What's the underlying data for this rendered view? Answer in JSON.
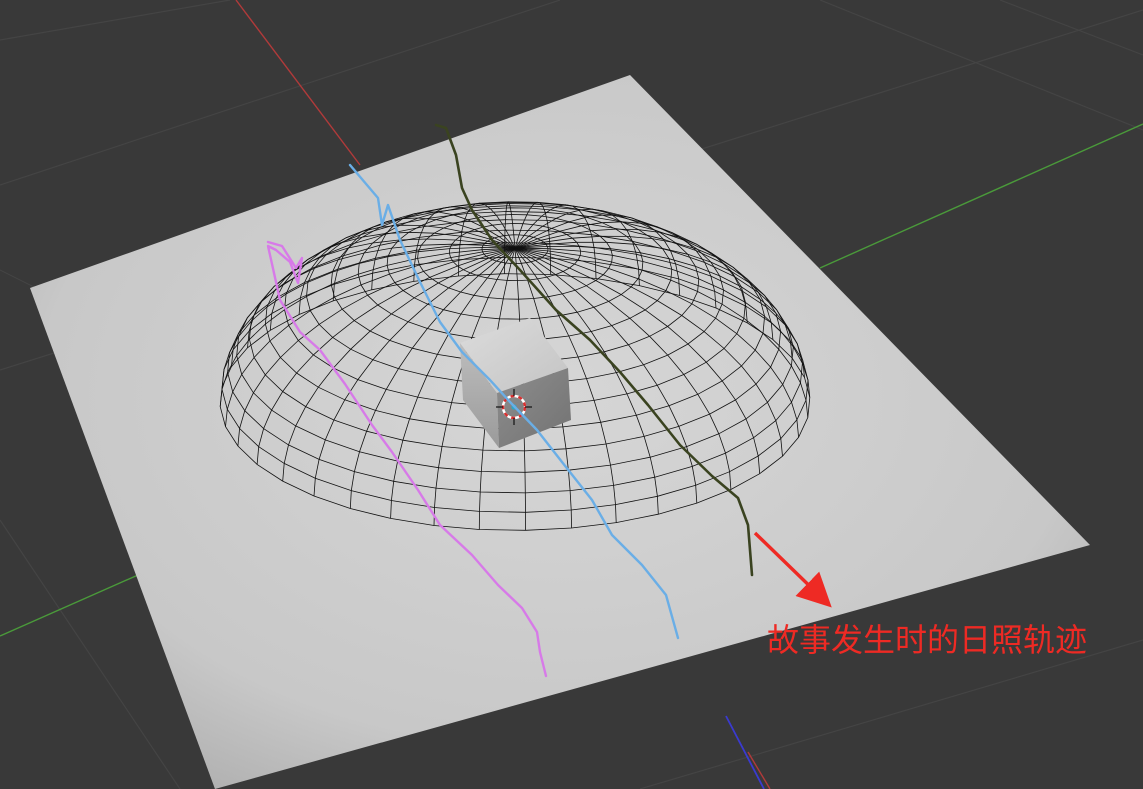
{
  "viewport": {
    "background_color": "#393939",
    "grid_color": "#444444",
    "ground_plane_color": "#cfcfcf",
    "wireframe_color": "#111111",
    "axis_x_color": "#b03a3a",
    "axis_y_color": "#4a9a3a",
    "axis_z_color": "#3a3ad0"
  },
  "sun_paths": [
    {
      "name": "path-pink",
      "color": "#d77ae8"
    },
    {
      "name": "path-blue",
      "color": "#6aaee6"
    },
    {
      "name": "path-olive",
      "color": "#3a4320"
    }
  ],
  "annotation": {
    "text": "故事发生时的日照轨迹",
    "color": "#ee2a24"
  }
}
